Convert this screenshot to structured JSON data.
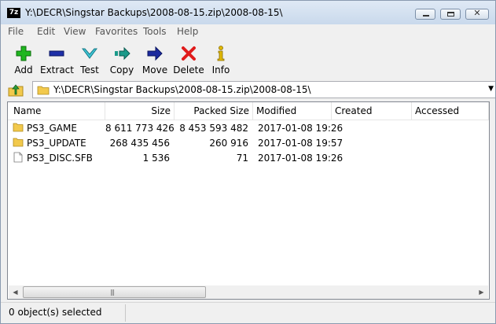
{
  "window": {
    "icon_text": "7z",
    "title": "Y:\\DECR\\Singstar Backups\\2008-08-15.zip\\2008-08-15\\"
  },
  "menu": [
    "File",
    "Edit",
    "View",
    "Favorites",
    "Tools",
    "Help"
  ],
  "toolbar": {
    "add": "Add",
    "extract": "Extract",
    "test": "Test",
    "copy": "Copy",
    "move": "Move",
    "delete": "Delete",
    "info": "Info"
  },
  "address": {
    "path": "Y:\\DECR\\Singstar Backups\\2008-08-15.zip\\2008-08-15\\"
  },
  "columns": {
    "name": "Name",
    "size": "Size",
    "packed": "Packed Size",
    "modified": "Modified",
    "created": "Created",
    "accessed": "Accessed"
  },
  "files": [
    {
      "name": "PS3_GAME",
      "type": "folder",
      "size": "8 611 773 426",
      "packed": "8 453 593 482",
      "modified": "2017-01-08 19:26"
    },
    {
      "name": "PS3_UPDATE",
      "type": "folder",
      "size": "268 435 456",
      "packed": "260 916",
      "modified": "2017-01-08 19:57"
    },
    {
      "name": "PS3_DISC.SFB",
      "type": "file",
      "size": "1 536",
      "packed": "71",
      "modified": "2017-01-08 19:26"
    }
  ],
  "status": {
    "selection": "0 object(s) selected"
  },
  "colors": {
    "folder": "#f2c94c",
    "add_icon": "#1fb61f",
    "extract_icon": "#1e2fa8",
    "test_icon": "#3fc6d6",
    "copy_icon": "#1b9a8a",
    "move_icon": "#1c2a9e",
    "delete_icon": "#e01b1b",
    "info_icon": "#e0b800"
  }
}
